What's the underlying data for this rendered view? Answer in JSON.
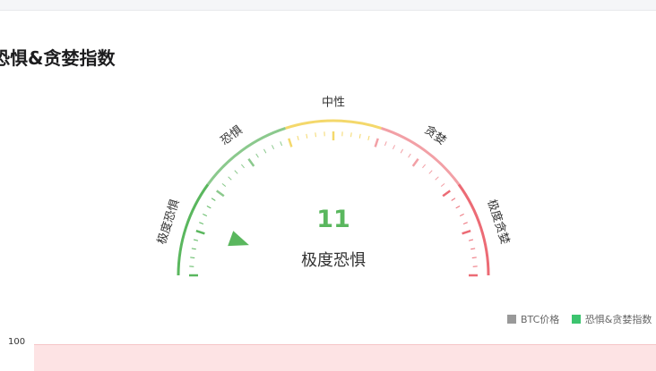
{
  "page": {
    "title": "恐惧&贪婪指数"
  },
  "gauge": {
    "value": "11",
    "status": "极度恐惧",
    "labels": [
      "极度恐惧",
      "恐惧",
      "中性",
      "贪婪",
      "极度贪婪"
    ],
    "colors": {
      "extreme_fear": "#5ab75e",
      "fear": "#8bc98d",
      "neutral": "#f4d86b",
      "greed": "#f2a0a6",
      "extreme_greed": "#ec6b75"
    }
  },
  "legend": {
    "items": [
      {
        "label": "BTC价格",
        "color": "#999999"
      },
      {
        "label": "恐惧&贪婪指数",
        "color": "#3cc46f"
      }
    ]
  },
  "chart": {
    "y_top_tick": "100",
    "band_color": "#fde3e4"
  }
}
